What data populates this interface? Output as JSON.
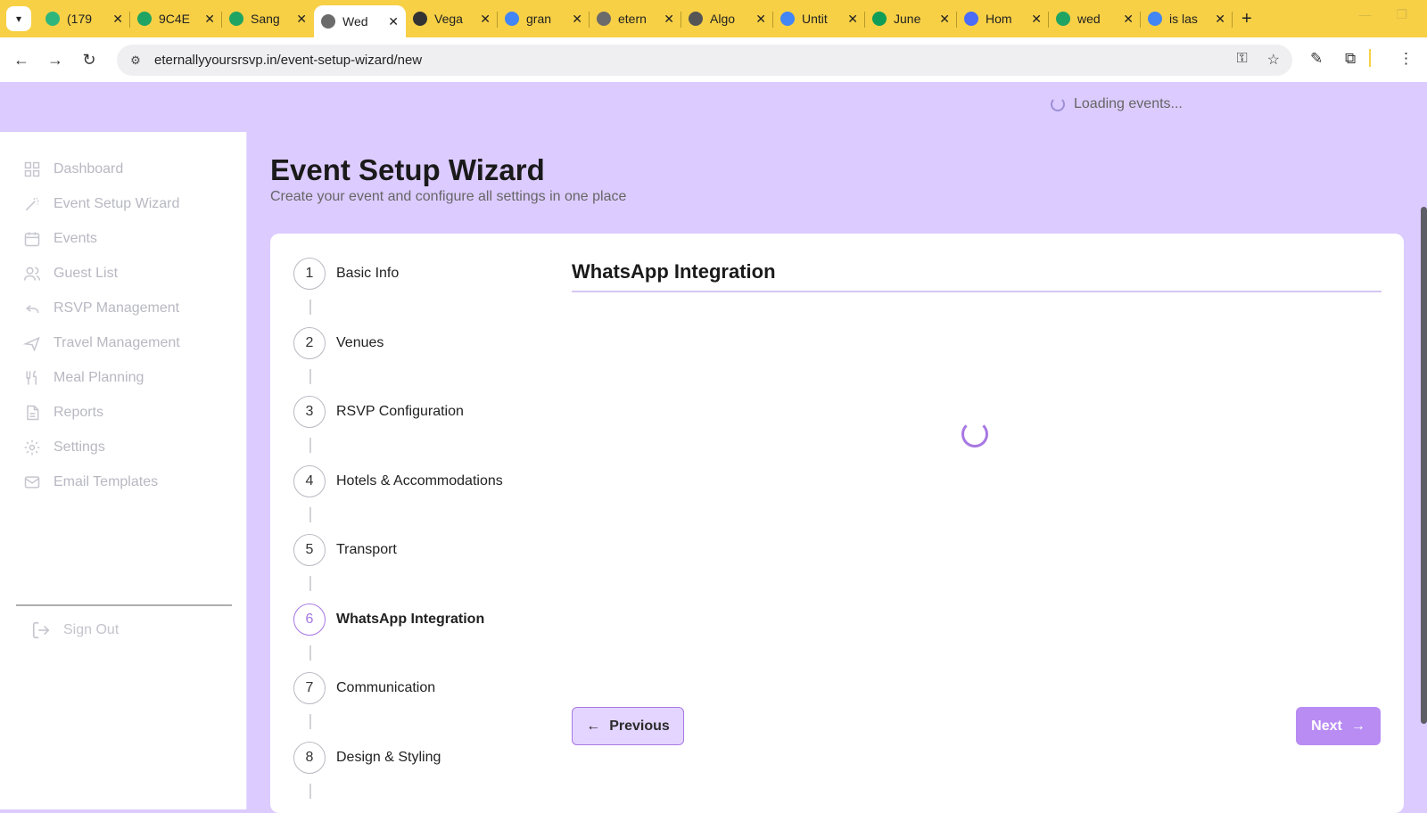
{
  "browser": {
    "tabs": [
      {
        "title": "(179",
        "color": "#2eb67d",
        "icon": "whatsapp-icon"
      },
      {
        "title": "9C4E",
        "color": "#1fa463",
        "icon": "drive-icon"
      },
      {
        "title": "Sang",
        "color": "#1fa463",
        "icon": "drive-icon"
      },
      {
        "title": "Wed",
        "color": "#6b6b6b",
        "icon": "globe-icon"
      },
      {
        "title": "Vega",
        "color": "#333333",
        "icon": "openai-icon"
      },
      {
        "title": "gran",
        "color": "#4285f4",
        "icon": "google-icon"
      },
      {
        "title": "etern",
        "color": "#6b6b6b",
        "icon": "globe-icon"
      },
      {
        "title": "Algo",
        "color": "#555555",
        "icon": "link-icon"
      },
      {
        "title": "Untit",
        "color": "#4285f4",
        "icon": "docs-icon"
      },
      {
        "title": "June",
        "color": "#0f9d58",
        "icon": "sheets-icon"
      },
      {
        "title": "Hom",
        "color": "#4a6cf7",
        "icon": "chrome-icon"
      },
      {
        "title": "wed",
        "color": "#1fa463",
        "icon": "drive-icon"
      },
      {
        "title": "is las",
        "color": "#4285f4",
        "icon": "google-icon"
      }
    ],
    "active_tab_index": 3,
    "url": "eternallyyoursrsvp.in/event-setup-wizard/new"
  },
  "header": {
    "loading_text": "Loading events..."
  },
  "sidebar": {
    "items": [
      {
        "label": "Dashboard",
        "icon": "dashboard-icon"
      },
      {
        "label": "Event Setup Wizard",
        "icon": "wand-icon"
      },
      {
        "label": "Events",
        "icon": "calendar-icon"
      },
      {
        "label": "Guest List",
        "icon": "users-icon"
      },
      {
        "label": "RSVP Management",
        "icon": "reply-icon"
      },
      {
        "label": "Travel Management",
        "icon": "plane-icon"
      },
      {
        "label": "Meal Planning",
        "icon": "utensils-icon"
      },
      {
        "label": "Reports",
        "icon": "file-icon"
      },
      {
        "label": "Settings",
        "icon": "gear-icon"
      },
      {
        "label": "Email Templates",
        "icon": "mail-icon"
      }
    ],
    "sign_out": "Sign Out"
  },
  "page": {
    "title": "Event Setup Wizard",
    "subtitle": "Create your event and configure all settings in one place"
  },
  "wizard": {
    "steps": [
      {
        "num": "1",
        "label": "Basic Info"
      },
      {
        "num": "2",
        "label": "Venues"
      },
      {
        "num": "3",
        "label": "RSVP Configuration"
      },
      {
        "num": "4",
        "label": "Hotels & Accommodations"
      },
      {
        "num": "5",
        "label": "Transport"
      },
      {
        "num": "6",
        "label": "WhatsApp Integration"
      },
      {
        "num": "7",
        "label": "Communication"
      },
      {
        "num": "8",
        "label": "Design & Styling"
      }
    ],
    "active_step": 6,
    "section_title": "WhatsApp Integration",
    "previous_label": "Previous",
    "next_label": "Next"
  }
}
